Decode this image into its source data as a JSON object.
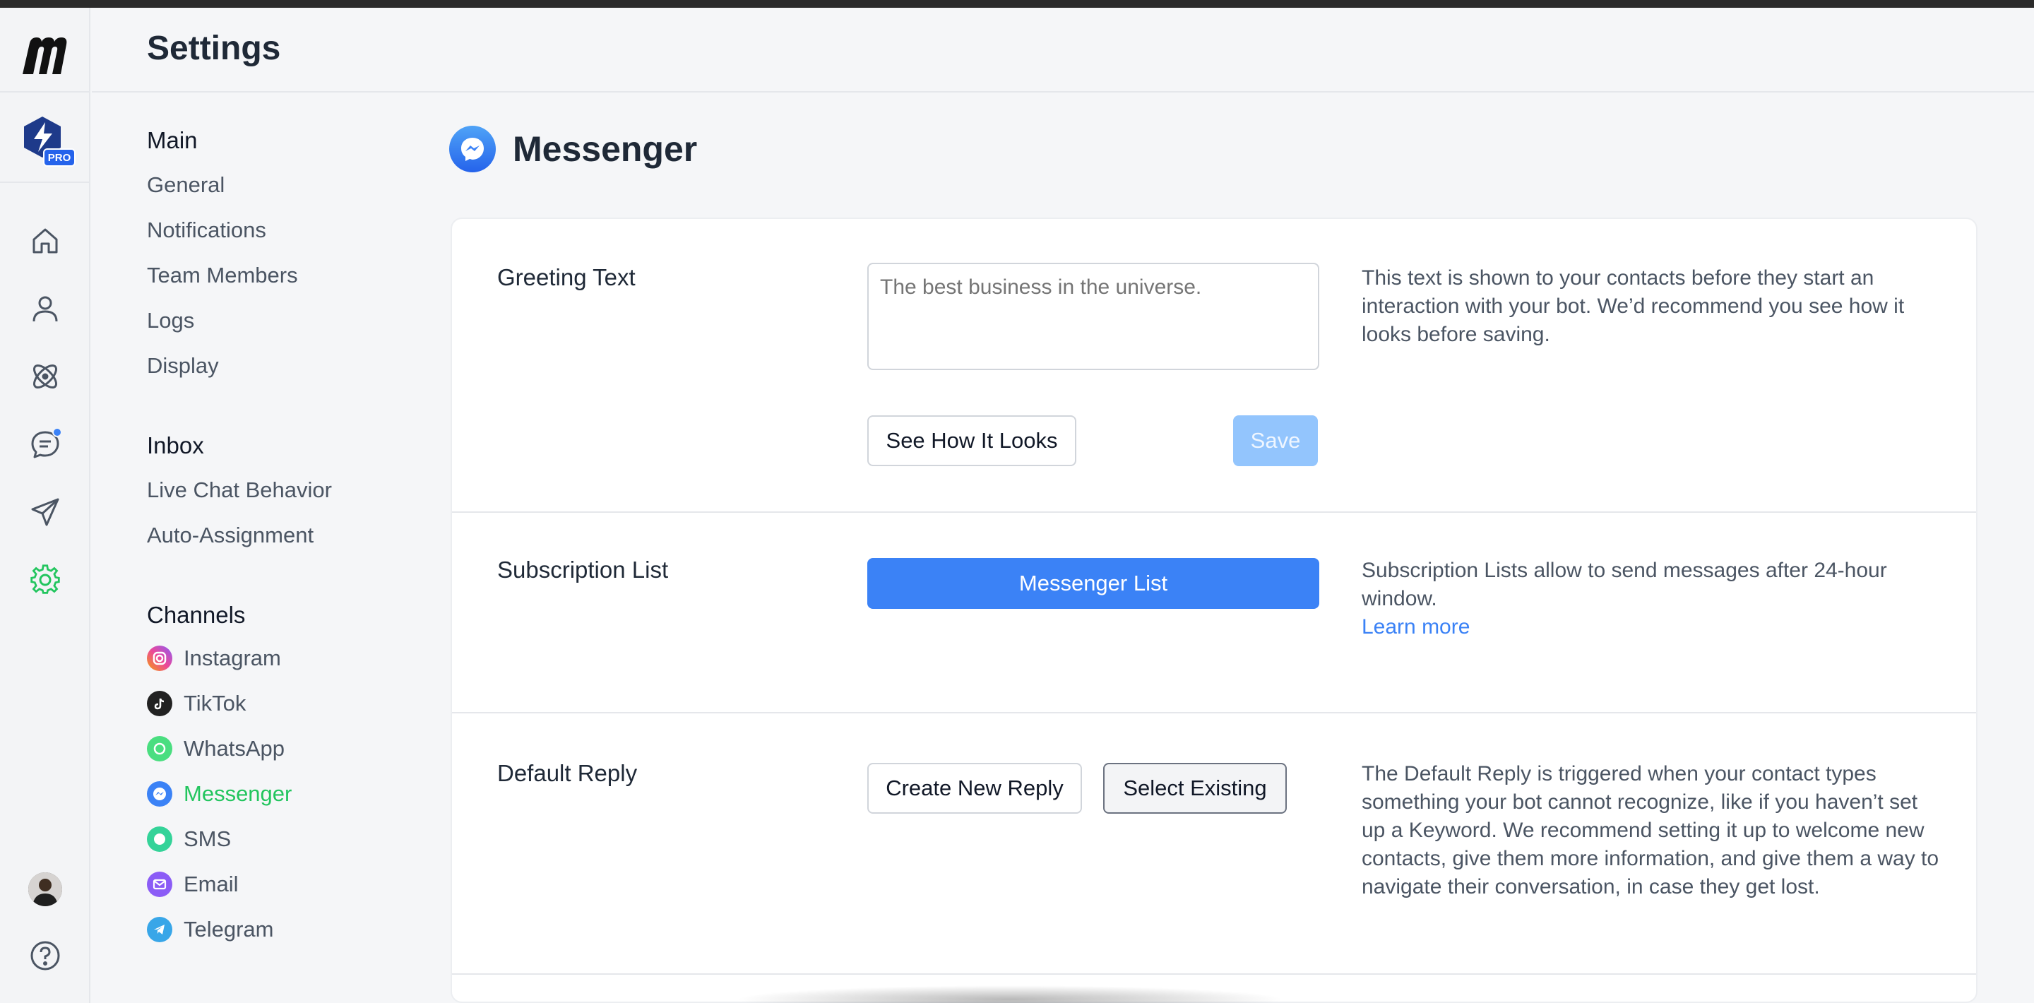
{
  "header": {
    "title": "Settings"
  },
  "rail": {
    "logo": "manychat-logo",
    "bot_badge": "PRO",
    "icons": [
      "home-icon",
      "user-icon",
      "automation-icon",
      "chat-icon",
      "send-icon",
      "gear-icon",
      "help-icon"
    ],
    "accent_active": "#22c55e",
    "notification_color": "#3b82f6"
  },
  "sidebar": {
    "main_title": "Main",
    "main_items": [
      "General",
      "Notifications",
      "Team Members",
      "Logs",
      "Display"
    ],
    "inbox_title": "Inbox",
    "inbox_items": [
      "Live Chat Behavior",
      "Auto-Assignment"
    ],
    "channels_title": "Channels",
    "channels": [
      {
        "label": "Instagram",
        "icon": "instagram-icon"
      },
      {
        "label": "TikTok",
        "icon": "tiktok-icon"
      },
      {
        "label": "WhatsApp",
        "icon": "whatsapp-icon"
      },
      {
        "label": "Messenger",
        "icon": "messenger-icon",
        "active": true
      },
      {
        "label": "SMS",
        "icon": "sms-icon"
      },
      {
        "label": "Email",
        "icon": "email-icon"
      },
      {
        "label": "Telegram",
        "icon": "telegram-icon"
      }
    ]
  },
  "page": {
    "title": "Messenger",
    "icon": "messenger-icon"
  },
  "sections": {
    "greeting": {
      "label": "Greeting Text",
      "placeholder": "The best business in the universe.",
      "preview_button": "See How It Looks",
      "save_button": "Save",
      "description": "This text is shown to your contacts before they start an interaction with your bot. We’d recommend you see how it looks before saving."
    },
    "subscription": {
      "label": "Subscription List",
      "button": "Messenger List",
      "description": "Subscription Lists allow to send messages after 24-hour window.",
      "link": "Learn more"
    },
    "default_reply": {
      "label": "Default Reply",
      "create_button": "Create New Reply",
      "select_button": "Select Existing",
      "description": "The Default Reply is triggered when your contact types something your bot cannot recognize, like if you haven’t set up a Keyword. We recommend setting it up to welcome new contacts, give them more information, and give them a way to navigate their conversation, in case they get lost."
    }
  }
}
